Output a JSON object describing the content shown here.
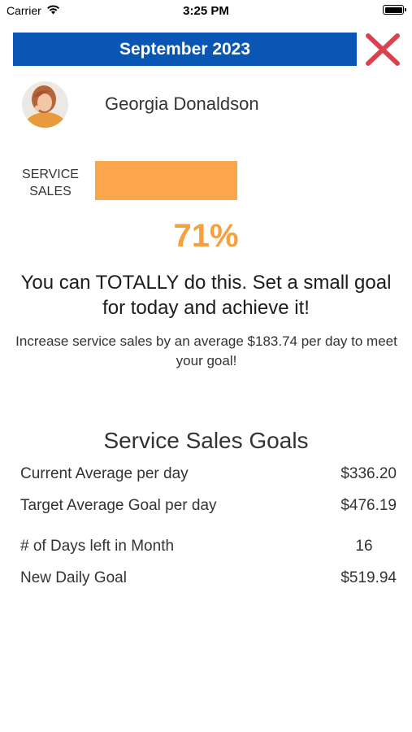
{
  "status_bar": {
    "carrier": "Carrier",
    "time": "3:25 PM",
    "icons": [
      "wifi-icon",
      "battery-icon"
    ]
  },
  "header": {
    "month": "September 2023",
    "close_icon": "close-icon",
    "close_color": "#d9434f",
    "bar_color": "#0a56b4"
  },
  "user": {
    "name": "Georgia Donaldson",
    "avatar_icon": "avatar"
  },
  "progress": {
    "label_line1": "SERVICE",
    "label_line2": "SALES",
    "fraction": 0.71,
    "percent_text": "71%",
    "color": "#fba64a"
  },
  "message": {
    "motivation": "You can TOTALLY do this.  Set a small goal for today and achieve it!",
    "tip": "Increase service sales by an average $183.74 per day to meet your goal!"
  },
  "goals": {
    "title": "Service Sales Goals",
    "rows": [
      {
        "label": "Current Average per day",
        "value": "$336.20"
      },
      {
        "label": "Target Average Goal per day",
        "value": "$476.19"
      },
      {
        "label": "# of Days left in Month",
        "value": "16"
      },
      {
        "label": "New Daily Goal",
        "value": "$519.94"
      }
    ]
  }
}
